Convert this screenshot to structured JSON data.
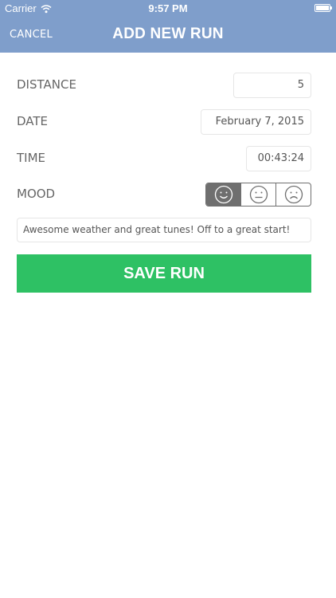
{
  "status_bar": {
    "carrier": "Carrier",
    "time": "9:57 PM"
  },
  "nav": {
    "cancel_label": "CANCEL",
    "title": "ADD NEW RUN"
  },
  "form": {
    "distance": {
      "label": "DISTANCE",
      "value": "5"
    },
    "date": {
      "label": "DATE",
      "value": "February 7, 2015"
    },
    "time": {
      "label": "TIME",
      "value": "00:43:24"
    },
    "mood": {
      "label": "MOOD",
      "options": [
        "happy-face-icon",
        "neutral-face-icon",
        "sad-face-icon"
      ],
      "selected": "happy-face-icon"
    },
    "note": "Awesome weather and great tunes! Off to a great start!"
  },
  "save_button": {
    "label": "SAVE RUN"
  },
  "colors": {
    "header": "#7f9ecb",
    "save": "#2ec164",
    "mood_selected": "#6f6f6f"
  }
}
